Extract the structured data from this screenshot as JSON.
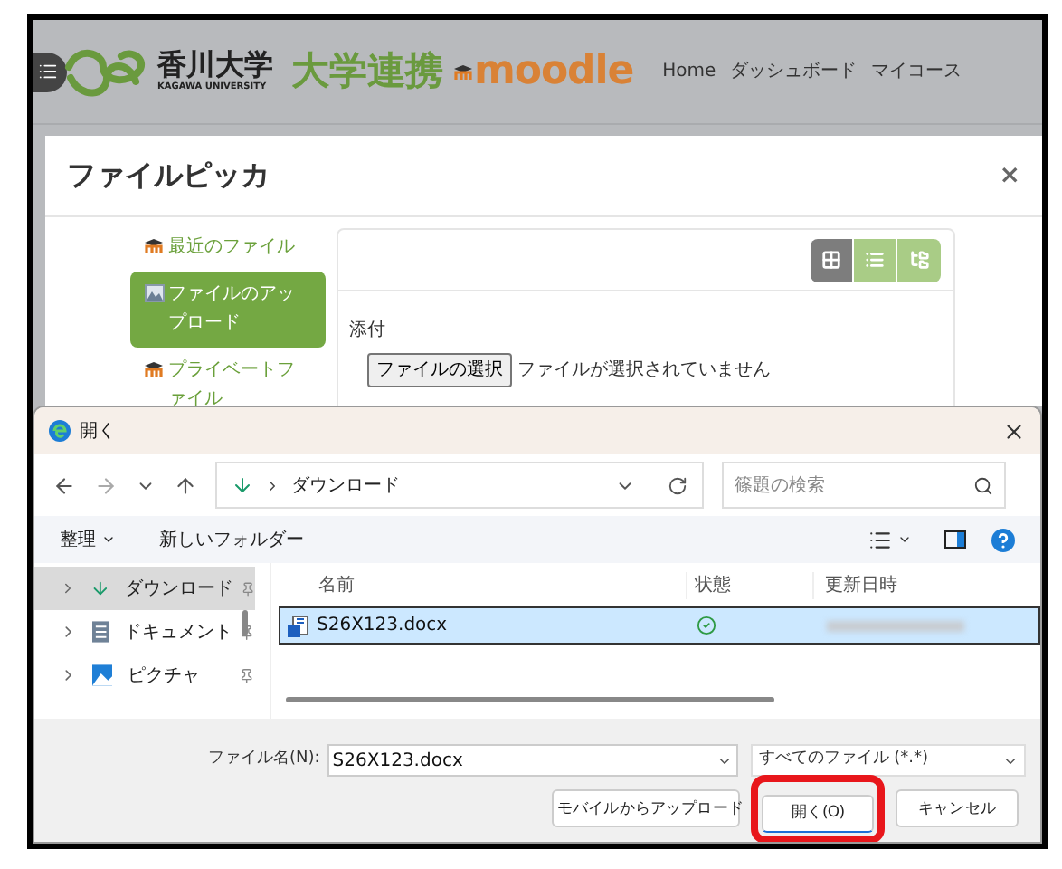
{
  "header": {
    "university_name": "香川大学",
    "university_name_en": "KAGAWA UNIVERSITY",
    "site_title": "大学連携",
    "brand": "moodle",
    "nav": [
      "Home",
      "ダッシュボード",
      "マイコース"
    ]
  },
  "file_picker": {
    "title": "ファイルピッカ",
    "close": "×",
    "repositories": [
      {
        "label": "最近のファイル",
        "kind": "moodle",
        "selected": false
      },
      {
        "label": "ファイルのアップロード",
        "kind": "upload",
        "selected": true
      },
      {
        "label": "プライベートファイル",
        "kind": "moodle",
        "selected": false
      }
    ],
    "view_modes": [
      {
        "kind": "icons",
        "selected": true
      },
      {
        "kind": "list",
        "selected": false
      },
      {
        "kind": "tree",
        "selected": false
      }
    ],
    "attachment_label": "添付",
    "choose_button": "ファイルの選択",
    "no_file_text": "ファイルが選択されていません"
  },
  "open_dialog": {
    "title": "開く",
    "address": "ダウンロード",
    "search_placeholder": "篠題の検索",
    "organize": "整理",
    "new_folder": "新しいフォルダー",
    "nav_items": [
      {
        "label": "ダウンロード",
        "kind": "download",
        "selected": true
      },
      {
        "label": "ドキュメント",
        "kind": "document",
        "selected": false
      },
      {
        "label": "ピクチャ",
        "kind": "picture",
        "selected": false
      }
    ],
    "columns": [
      "名前",
      "状態",
      "更新日時"
    ],
    "files": [
      {
        "name": "S26X123.docx",
        "selected": true,
        "synced": true
      }
    ],
    "file_name_label": "ファイル名(N):",
    "file_name_value": "S26X123.docx",
    "file_type": "すべてのファイル (*.*)",
    "buttons": [
      {
        "label": "モバイルからアップロード",
        "highlighted": false
      },
      {
        "label": "開く(O)",
        "highlighted": true
      },
      {
        "label": "キャンセル",
        "highlighted": false
      }
    ]
  }
}
